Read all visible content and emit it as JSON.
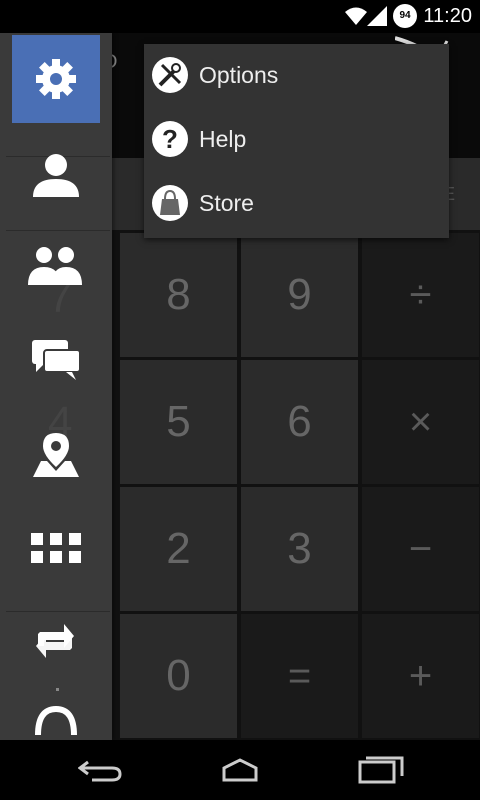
{
  "status": {
    "time": "11:20",
    "battery": "94"
  },
  "display": {
    "partial_text": "D"
  },
  "delete_label": "DELETE",
  "keypad": {
    "row1": [
      "8",
      "9",
      "÷"
    ],
    "row2": [
      "5",
      "6",
      "×"
    ],
    "row3": [
      "2",
      "3",
      "−"
    ],
    "row4": [
      "0",
      "=",
      "+"
    ]
  },
  "behind_drawer_digits": [
    "7",
    "4"
  ],
  "menu": {
    "items": [
      {
        "label": "Options",
        "icon": "wrench-screwdriver-icon"
      },
      {
        "label": "Help",
        "icon": "question-icon"
      },
      {
        "label": "Store",
        "icon": "shopping-bag-icon"
      }
    ]
  },
  "drawer": {
    "items": [
      "settings-gear-icon",
      "contact-icon",
      "group-icon",
      "chat-icon",
      "location-pin-icon",
      "apps-grid-icon",
      "sync-icon",
      "headset-icon"
    ],
    "active_color": "#4a6fb5"
  }
}
